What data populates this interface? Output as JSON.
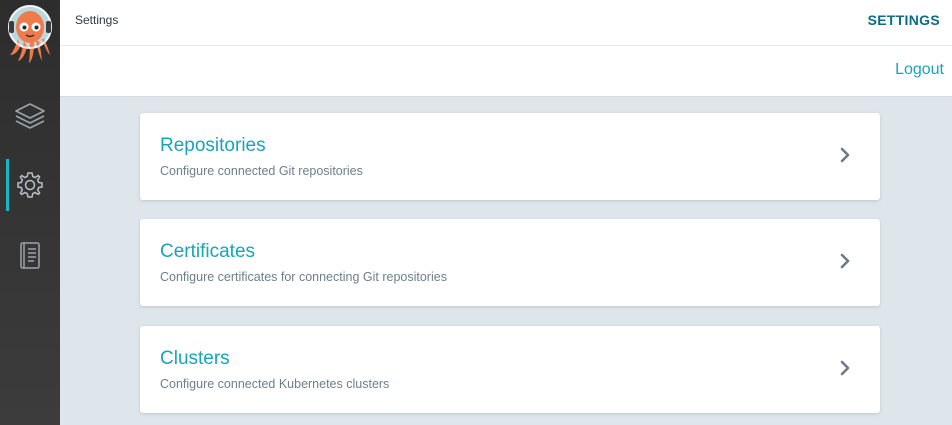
{
  "header": {
    "breadcrumb": "Settings",
    "title": "SETTINGS"
  },
  "actions": {
    "logout_label": "Logout"
  },
  "sidebar": {
    "items": [
      {
        "name": "applications",
        "icon": "layers-icon",
        "active": false
      },
      {
        "name": "settings",
        "icon": "gear-icon",
        "active": true
      },
      {
        "name": "user-info",
        "icon": "notebook-icon",
        "active": false
      }
    ]
  },
  "cards": [
    {
      "title": "Repositories",
      "description": "Configure connected Git repositories"
    },
    {
      "title": "Certificates",
      "description": "Configure certificates for connecting Git repositories"
    },
    {
      "title": "Clusters",
      "description": "Configure connected Kubernetes clusters"
    }
  ],
  "colors": {
    "accent": "#18a5b8",
    "active_indicator": "#18b6c4",
    "sidebar_bg": "#353535",
    "page_bg": "#dee6eb",
    "title_dark_teal": "#0d6c85"
  }
}
